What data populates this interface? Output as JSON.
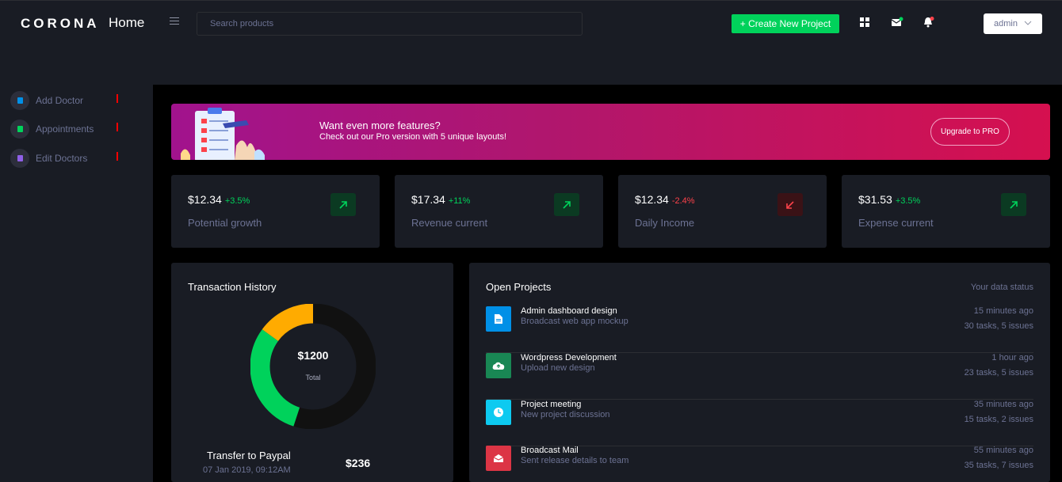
{
  "navbar": {
    "brand": "CORONA",
    "title": "Home",
    "search_placeholder": "Search products",
    "create_button": "+ Create New Project",
    "user_label": "admin"
  },
  "sidebar": {
    "items": [
      {
        "label": "Add Doctor",
        "color": "#0090e7"
      },
      {
        "label": "Appointments",
        "color": "#00d25b"
      },
      {
        "label": "Edit Doctors",
        "color": "#8f5fe8"
      }
    ]
  },
  "banner": {
    "title": "Want even more features?",
    "subtitle": "Check out our Pro version with 5 unique layouts!",
    "button": "Upgrade to PRO"
  },
  "stats": [
    {
      "amount": "$12.34",
      "change": "+3.5%",
      "label": "Potential growth",
      "trend": "up"
    },
    {
      "amount": "$17.34",
      "change": "+11%",
      "label": "Revenue current",
      "trend": "up"
    },
    {
      "amount": "$12.34",
      "change": "-2.4%",
      "label": "Daily Income",
      "trend": "down"
    },
    {
      "amount": "$31.53",
      "change": "+3.5%",
      "label": "Expense current",
      "trend": "up"
    }
  ],
  "transaction": {
    "title": "Transaction History",
    "total_amount": "$1200",
    "total_label": "Total",
    "donut_segments": [
      {
        "value": 55,
        "color": "#111111"
      },
      {
        "value": 30,
        "color": "#00d25b"
      },
      {
        "value": 15,
        "color": "#ffab00"
      }
    ],
    "item": {
      "title": "Transfer to Paypal",
      "date": "07 Jan 2019, 09:12AM",
      "amount": "$236"
    }
  },
  "projects": {
    "title": "Open Projects",
    "subtitle": "Your data status",
    "items": [
      {
        "name": "Admin dashboard design",
        "desc": "Broadcast web app mockup",
        "time": "15 minutes ago",
        "tasks": "30 tasks, 5 issues",
        "color": "#0090e7",
        "icon": "file-icon"
      },
      {
        "name": "Wordpress Development",
        "desc": "Upload new design",
        "time": "1 hour ago",
        "tasks": "23 tasks, 5 issues",
        "color": "#198754",
        "icon": "cloud-upload-icon"
      },
      {
        "name": "Project meeting",
        "desc": "New project discussion",
        "time": "35 minutes ago",
        "tasks": "15 tasks, 2 issues",
        "color": "#0dcaf0",
        "icon": "clock-icon"
      },
      {
        "name": "Broadcast Mail",
        "desc": "Sent release details to team",
        "time": "55 minutes ago",
        "tasks": "35 tasks, 7 issues",
        "color": "#dc3545",
        "icon": "mail-open-icon"
      }
    ]
  },
  "colors": {
    "success": "#00d25b",
    "danger": "#fc424a",
    "card_bg": "#191c24",
    "muted": "#6c7293"
  }
}
